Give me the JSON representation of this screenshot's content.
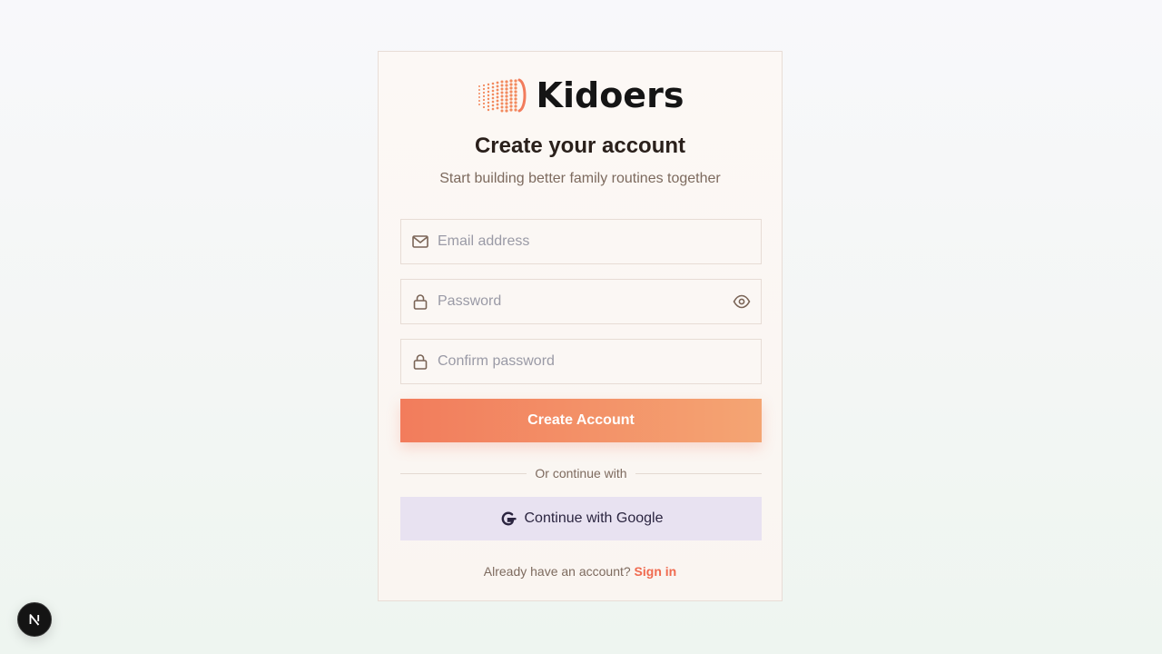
{
  "brand": {
    "name": "Kidoers",
    "accent_color": "#f27c5c"
  },
  "heading": {
    "title": "Create your account",
    "subtitle": "Start building better family routines together"
  },
  "form": {
    "email": {
      "placeholder": "Email address",
      "value": "",
      "icon": "mail-icon"
    },
    "password": {
      "placeholder": "Password",
      "value": "",
      "icon": "lock-icon",
      "toggle_icon": "eye-icon"
    },
    "confirm_password": {
      "placeholder": "Confirm password",
      "value": "",
      "icon": "lock-icon"
    },
    "submit_label": "Create Account"
  },
  "divider": {
    "label": "Or continue with"
  },
  "oauth": {
    "google_label": "Continue with Google",
    "icon": "google-icon"
  },
  "footer": {
    "prompt": "Already have an account?",
    "link_label": "Sign in"
  },
  "dev_badge": {
    "icon": "nextjs-icon"
  }
}
